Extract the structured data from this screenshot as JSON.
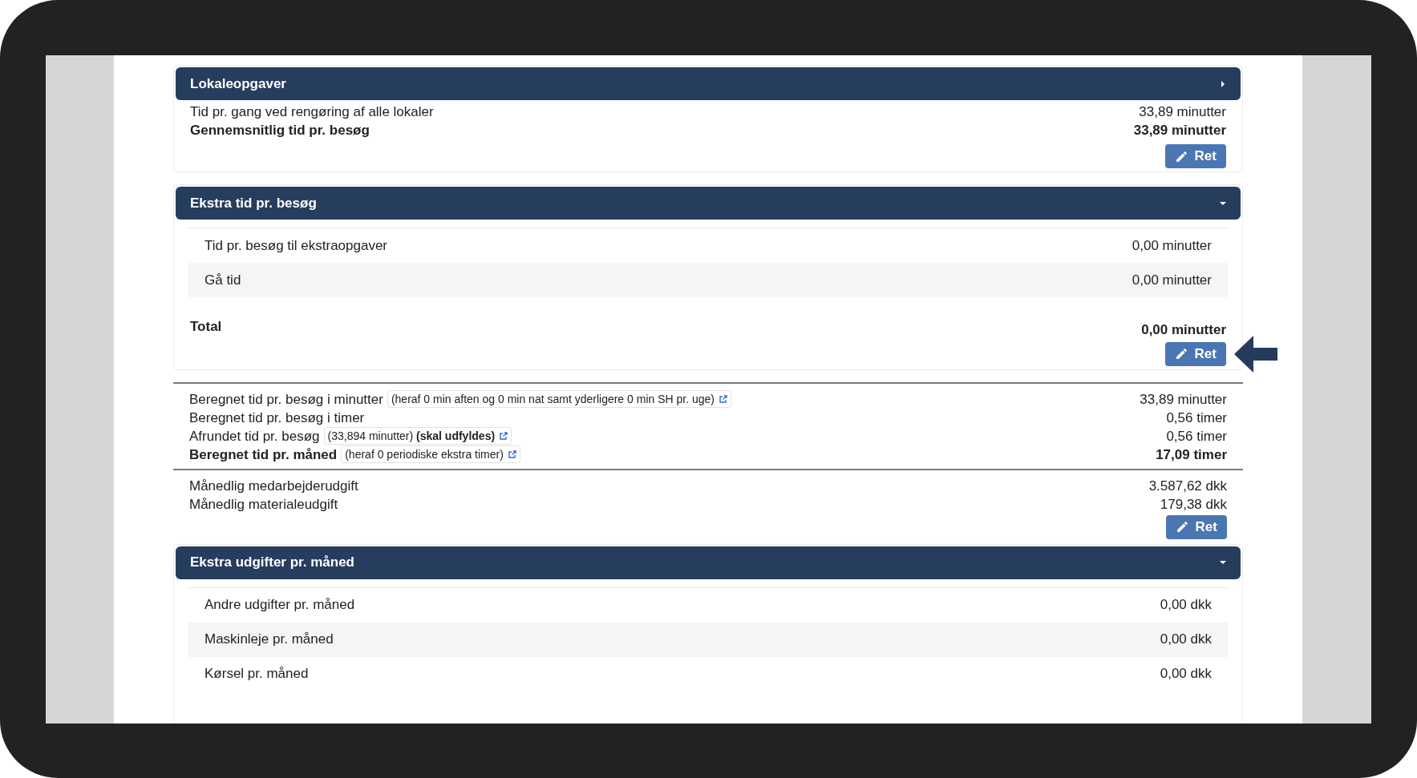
{
  "blocks": [
    {
      "kind": "panel",
      "title": "Lokaleopgaver",
      "expanded": false,
      "lines": [
        {
          "label": "Tid pr. gang ved rengøring af alle lokaler",
          "value": "33,89 minutter",
          "bold": false
        },
        {
          "label": "Gennemsnitlig tid pr. besøg",
          "value": "33,89 minutter",
          "bold": true
        }
      ],
      "button": "Ret",
      "pointed": false
    },
    {
      "kind": "panel",
      "title": "Ekstra tid pr. besøg",
      "expanded": true,
      "rows": [
        {
          "label": "Tid pr. besøg til ekstraopgaver",
          "value": "0,00 minutter"
        },
        {
          "label": "Gå tid",
          "value": "0,00 minutter"
        }
      ],
      "total": {
        "label": "Total",
        "value": "0,00 minutter"
      },
      "button": "Ret",
      "pointed": true
    },
    {
      "kind": "summary",
      "lines": [
        {
          "label": "Beregnet tid pr. besøg i minutter",
          "note": "(heraf 0 min aften og 0 min nat samt yderligere 0 min SH pr. uge)",
          "value": "33,89 minutter",
          "bold": false
        },
        {
          "label": "Beregnet tid pr. besøg i timer",
          "value": "0,56 timer",
          "bold": false
        },
        {
          "label": "Afrundet tid pr. besøg",
          "note": "(33,894 minutter) **(skal udfyldes)**",
          "value": "0,56 timer",
          "bold": false
        },
        {
          "label": "Beregnet tid pr. måned",
          "note": "(heraf 0 periodiske ekstra timer)",
          "value": "17,09 timer",
          "bold": true
        }
      ]
    },
    {
      "kind": "summary",
      "lines": [
        {
          "label": "Månedlig medarbejderudgift",
          "value": "3.587,62 dkk",
          "bold": false
        },
        {
          "label": "Månedlig materialeudgift",
          "value": "179,38 dkk",
          "bold": false
        }
      ],
      "button": "Ret"
    },
    {
      "kind": "panel",
      "title": "Ekstra udgifter pr. måned",
      "expanded": true,
      "rows": [
        {
          "label": "Andre udgifter pr. måned",
          "value": "0,00 dkk"
        },
        {
          "label": "Maskinleje pr. måned",
          "value": "0,00 dkk"
        },
        {
          "label": "Kørsel pr. måned",
          "value": "0,00 dkk"
        }
      ]
    }
  ]
}
